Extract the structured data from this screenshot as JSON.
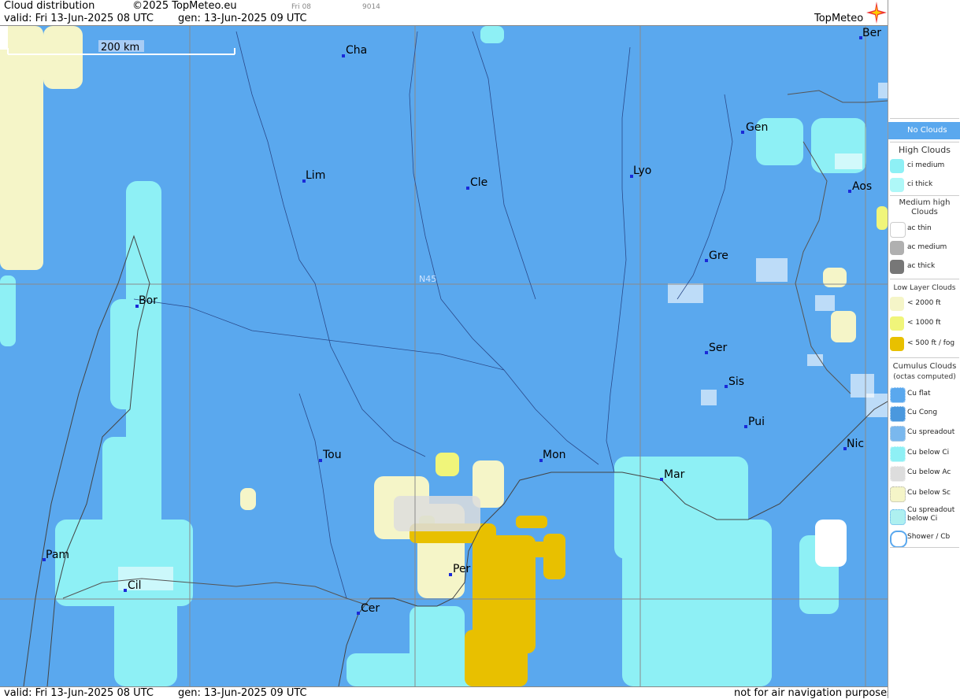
{
  "header": {
    "title": "Cloud distribution",
    "copyright": "©2025 TopMeteo.eu",
    "valid": "valid:  Fri  13-Jun-2025  08 UTC",
    "gen": "gen: 13-Jun-2025 09 UTC",
    "tiny1": "Fri 08",
    "tiny2": "9014",
    "logo": "TopMeteo"
  },
  "footer": {
    "valid": "valid:  Fri  13-Jun-2025  08 UTC",
    "gen": "gen: 13-Jun-2025 09 UTC",
    "disclaimer": "not for air navigation purposes"
  },
  "map": {
    "scale_label": "200 km",
    "lat_label": "N45",
    "cities": [
      {
        "name": "Cha"
      },
      {
        "name": "Ber"
      },
      {
        "name": "Gen"
      },
      {
        "name": "Lim"
      },
      {
        "name": "Cle"
      },
      {
        "name": "Lyo"
      },
      {
        "name": "Aos"
      },
      {
        "name": "Gre"
      },
      {
        "name": "Bor"
      },
      {
        "name": "Ser"
      },
      {
        "name": "Sis"
      },
      {
        "name": "Pui"
      },
      {
        "name": "Tou"
      },
      {
        "name": "Mon"
      },
      {
        "name": "Mar"
      },
      {
        "name": "Nic"
      },
      {
        "name": "Pam"
      },
      {
        "name": "Cil"
      },
      {
        "name": "Per"
      },
      {
        "name": "Cer"
      }
    ]
  },
  "legend": {
    "no_clouds": "No Clouds",
    "high_title": "High Clouds",
    "ci_medium": "ci medium",
    "ci_thick": "ci thick",
    "medium_title": "Medium high Clouds",
    "ac_thin": "ac thin",
    "ac_medium": "ac medium",
    "ac_thick": "ac thick",
    "low_title": "Low Layer Clouds",
    "low_2000": "< 2000 ft",
    "low_1000": "< 1000 ft",
    "low_500": "< 500 ft / fog",
    "cu_title": "Cumulus Clouds",
    "cu_sub": "(octas computed)",
    "cu_flat": "Cu flat",
    "cu_cong": "Cu Cong",
    "cu_spreadout": "Cu spreadout",
    "cu_below_ci": "Cu below Ci",
    "cu_below_ac": "Cu below Ac",
    "cu_below_sc": "Cu below Sc",
    "cu_spread_ci": "Cu spreadout below Ci",
    "shower": "Shower / Cb"
  },
  "colors": {
    "no_clouds": "#5aa8ee",
    "ci": "#8ef0f5",
    "low_2000": "#f5f5c8",
    "low_1000": "#f0f57a",
    "fog": "#e8c000"
  }
}
